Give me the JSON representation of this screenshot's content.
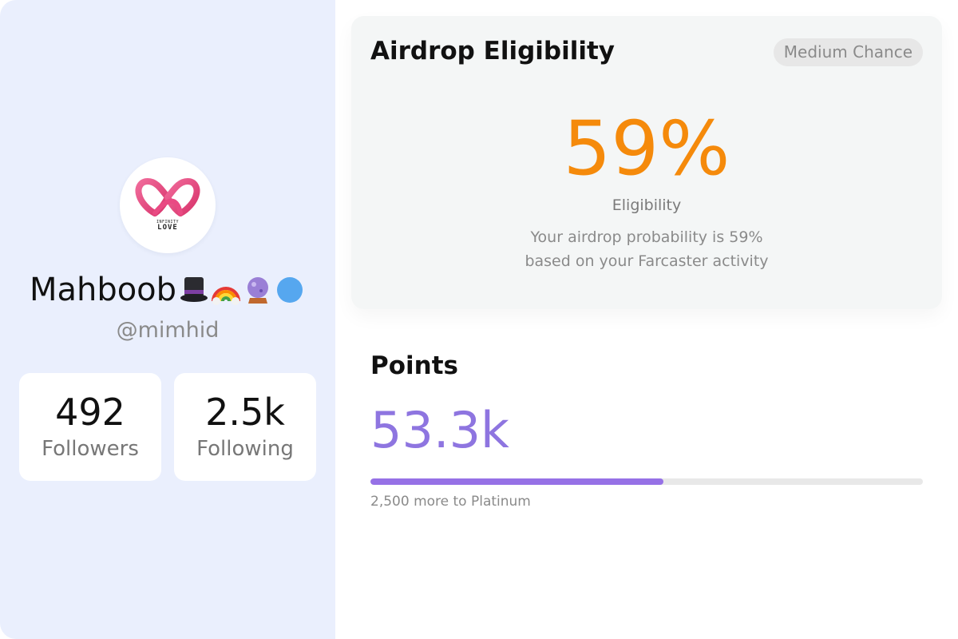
{
  "profile": {
    "avatar_logo_small": "INFINITY",
    "avatar_logo_text": "LOVE",
    "display_name": "Mahboob",
    "name_emojis": [
      "top-hat-icon",
      "rainbow-icon",
      "crystal-ball-icon",
      "blue-circle-icon"
    ],
    "username": "@mimhid",
    "followers_value": "492",
    "followers_label": "Followers",
    "following_value": "2.5k",
    "following_label": "Following"
  },
  "eligibility": {
    "title": "Airdrop Eligibility",
    "badge": "Medium Chance",
    "percent": "59%",
    "label": "Eligibility",
    "description_line1": "Your airdrop probability is 59%",
    "description_line2": "based on your Farcaster activity"
  },
  "points": {
    "title": "Points",
    "value": "53.3k",
    "progress_fraction": 0.53,
    "caption": "2,500 more to Platinum"
  },
  "colors": {
    "eligibility_accent": "#f58a0b",
    "points_accent": "#8e75e0",
    "progress_fill": "#9671e6",
    "sidebar_bg": "#eaeffd"
  }
}
